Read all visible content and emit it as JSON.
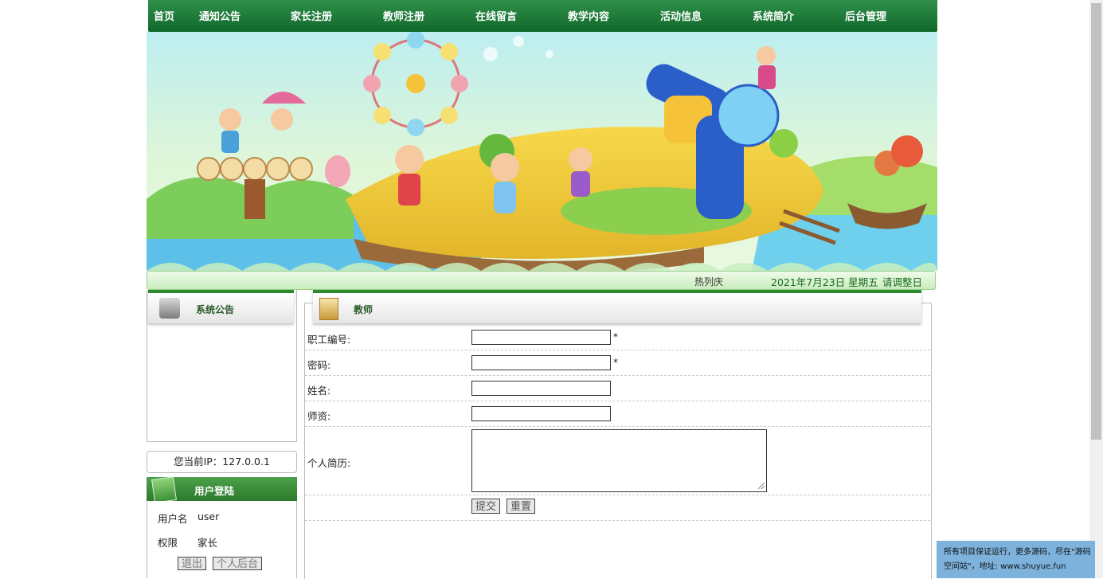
{
  "nav": {
    "items": [
      "首页",
      "通知公告",
      "家长注册",
      "教师注册",
      "在线留言",
      "教学内容",
      "活动信息",
      "系统简介",
      "后台管理"
    ]
  },
  "marquee": {
    "hot": "热列庆",
    "date": "2021年7月23日 星期五",
    "tip": "请调整日期!"
  },
  "sidebar": {
    "notice_title": "系统公告",
    "ip_text": "您当前IP：127.0.0.1",
    "login_title": "用户登陆",
    "username_label": "用户名",
    "username_value": "user",
    "role_label": "权限",
    "role_value": "家长",
    "logout_label": "退出",
    "backend_label": "个人后台"
  },
  "form": {
    "title": "教师",
    "fields": [
      {
        "label": "职工编号:",
        "value": "",
        "required": "*"
      },
      {
        "label": "密码:",
        "value": "",
        "required": "*"
      },
      {
        "label": "姓名:",
        "value": ""
      },
      {
        "label": "师资:",
        "value": ""
      },
      {
        "label": "个人简历:",
        "value": ""
      }
    ],
    "submit_label": "提交",
    "reset_label": "重置"
  },
  "footer": {
    "line1": "所有项目保证运行，更多源码，尽在\"源码",
    "line2": "空间站\"，地址: www.shuyue.fun"
  },
  "colors": {
    "nav_green": "#10682b",
    "accent_green": "#2a8a2e",
    "footnote_blue": "#7db2dc"
  }
}
